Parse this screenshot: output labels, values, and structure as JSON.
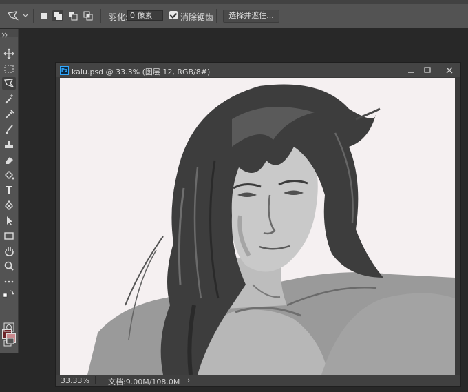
{
  "options_bar": {
    "feather_label": "羽化:",
    "feather_value": "0 像素",
    "antialias_label": "消除锯齿",
    "antialias_checked": true,
    "select_and_mask_label": "选择并遮住..."
  },
  "document": {
    "title": "kalu.psd @ 33.3% (图层 12, RGB/8#)",
    "app_icon_text": "Ps",
    "zoom": "33.33%",
    "doc_size": "文档:9.00M/108.0M",
    "status_arrow": "›"
  },
  "toolbox": {
    "foreground_color": "#6d2328",
    "background_color": "#c98a8e",
    "tools": [
      "move-icon",
      "marquee-icon",
      "lasso-icon",
      "magic-wand-icon",
      "eyedropper-icon",
      "healing-brush-icon",
      "brush-icon",
      "clone-stamp-icon",
      "eraser-icon",
      "paint-bucket-icon",
      "type-icon",
      "pen-icon",
      "path-selection-icon",
      "rectangle-icon",
      "hand-icon",
      "zoom-icon",
      "more-tools-icon"
    ]
  },
  "colors": {
    "app_bg": "#282828",
    "panel_bg": "#535353",
    "canvas_bg": "#f5f0f1",
    "accent": "#31a8ff"
  }
}
